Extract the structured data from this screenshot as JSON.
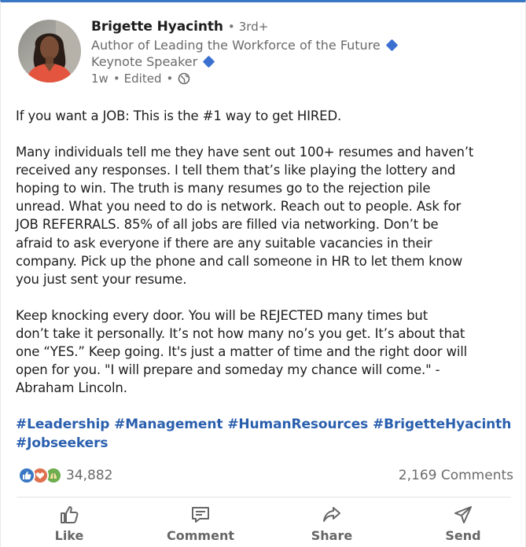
{
  "post": {
    "author": {
      "name": "Brigette Hyacinth",
      "degree": "3rd+",
      "headline_1": "Author of Leading the Workforce of the Future",
      "headline_2": "Keynote Speaker",
      "posted": "1w",
      "edited": "Edited"
    },
    "body": {
      "para1": [
        "If you want a JOB: This is the #1 way to get HIRED."
      ],
      "para2": [
        "Many individuals tell me they have sent out 100+ resumes and haven’t",
        "received any responses. I tell them that’s like playing the lottery and",
        "hoping to win. The truth is many resumes go to the rejection pile",
        "unread. What you need to do is network. Reach out to people. Ask for",
        "JOB REFERRALS. 85% of all jobs are filled via networking. Don’t be",
        "afraid to ask everyone if there are any suitable vacancies in their",
        "company. Pick up the phone and call someone in HR to let them know",
        "you just sent your resume."
      ],
      "para3": [
        "Keep knocking every door. You will be REJECTED many times but",
        "don’t take it personally. It’s not how many no’s you get. It’s about that",
        "one “YES.” Keep going. It's just a matter of time and the right door will",
        "open for you. \"I will prepare and someday my chance will come.\" -",
        "Abraham Lincoln."
      ]
    },
    "hashtags": {
      "line1": "#Leadership #Management #HumanResources #BrigetteHyacinth",
      "line2": "#Jobseekers"
    },
    "social": {
      "reaction_count": "34,882",
      "comments": "2,169 Comments"
    },
    "actions": {
      "like": "Like",
      "comment": "Comment",
      "share": "Share",
      "send": "Send"
    },
    "icons": {
      "verified": "blue-diamond-icon",
      "visibility": "globe-icon",
      "reactions": [
        "like-reaction-icon",
        "love-reaction-icon",
        "support-reaction-icon"
      ]
    },
    "colors": {
      "accent": "#3b78c4",
      "hashtag": "#2a5fae",
      "muted": "#6a6a6a"
    }
  }
}
